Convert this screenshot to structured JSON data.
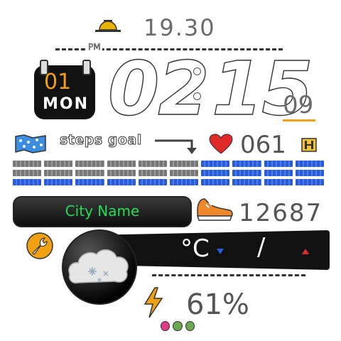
{
  "top": {
    "time_secondary": "19.30",
    "ampm": "PM"
  },
  "calendar": {
    "day_number": "01",
    "weekday": "MON"
  },
  "clock": {
    "hours": "02",
    "minutes": "15",
    "seconds": "09",
    "separator": ":"
  },
  "steps_goal": {
    "label": "steps goal"
  },
  "heart_rate": {
    "value": "061"
  },
  "steps": {
    "count": "12687"
  },
  "city": {
    "name": "City Name"
  },
  "weather": {
    "unit": "°C",
    "separator": "/"
  },
  "battery": {
    "percent_text": "61%"
  },
  "colors": {
    "city_text": "#22dd55",
    "blue_bar": "#2a5bd7",
    "heart": "#e02a2a",
    "accent_orange": "#f0a010"
  },
  "progress_rows": [
    {
      "gray": 6,
      "blue": 4
    },
    {
      "gray": 6,
      "blue": 4
    },
    {
      "gray": 0,
      "blue": 10
    }
  ]
}
